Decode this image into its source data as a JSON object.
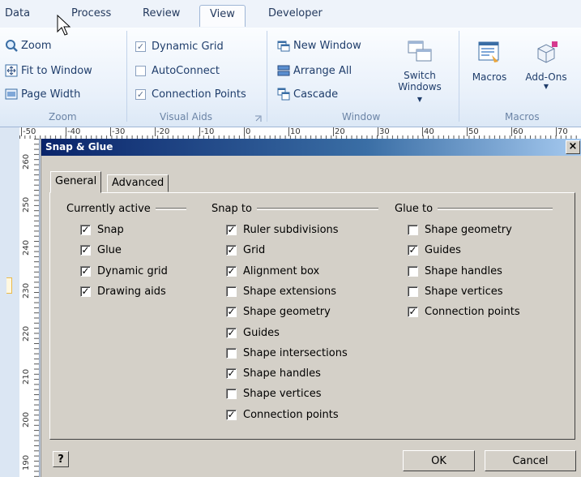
{
  "ribbon_tabs": [
    {
      "label": "Data"
    },
    {
      "label": "Process"
    },
    {
      "label": "Review"
    },
    {
      "label": "View",
      "active": true
    },
    {
      "label": "Developer"
    }
  ],
  "zoom_group": {
    "label": "Zoom",
    "buttons": [
      {
        "label": "Zoom",
        "icon": "magnifier-icon"
      },
      {
        "label": "Fit to Window",
        "icon": "fit-window-icon"
      },
      {
        "label": "Page Width",
        "icon": "page-width-icon"
      }
    ]
  },
  "visual_aids_group": {
    "label": "Visual Aids",
    "items": [
      {
        "label": "Dynamic Grid",
        "checked": true
      },
      {
        "label": "AutoConnect",
        "checked": false
      },
      {
        "label": "Connection Points",
        "checked": true
      }
    ]
  },
  "window_group": {
    "label": "Window",
    "buttons": [
      {
        "label": "New Window"
      },
      {
        "label": "Arrange All"
      },
      {
        "label": "Cascade"
      }
    ],
    "switch_windows": "Switch Windows"
  },
  "macros_group": {
    "label": "Macros",
    "macros": "Macros",
    "addons": "Add-Ons"
  },
  "ruler": {
    "h_labels": [
      "-50",
      "-40",
      "-30",
      "-20",
      "-10",
      "0",
      "10",
      "20",
      "30",
      "40",
      "50",
      "60",
      "70"
    ],
    "v_labels": [
      "260",
      "250",
      "240",
      "230",
      "220",
      "210",
      "200",
      "190"
    ]
  },
  "dialog": {
    "title": "Snap & Glue",
    "tabs": [
      {
        "label": "General",
        "selected": true
      },
      {
        "label": "Advanced",
        "selected": false
      }
    ],
    "currently_active": {
      "heading": "Currently active",
      "items": [
        {
          "label": "Snap",
          "checked": true
        },
        {
          "label": "Glue",
          "checked": true
        },
        {
          "label": "Dynamic grid",
          "checked": true
        },
        {
          "label": "Drawing aids",
          "checked": true
        }
      ]
    },
    "snap_to": {
      "heading": "Snap to",
      "items": [
        {
          "label": "Ruler subdivisions",
          "checked": true
        },
        {
          "label": "Grid",
          "checked": true
        },
        {
          "label": "Alignment box",
          "checked": true
        },
        {
          "label": "Shape extensions",
          "checked": false
        },
        {
          "label": "Shape geometry",
          "checked": true
        },
        {
          "label": "Guides",
          "checked": true
        },
        {
          "label": "Shape intersections",
          "checked": false
        },
        {
          "label": "Shape handles",
          "checked": true
        },
        {
          "label": "Shape vertices",
          "checked": false
        },
        {
          "label": "Connection points",
          "checked": true
        }
      ]
    },
    "glue_to": {
      "heading": "Glue to",
      "items": [
        {
          "label": "Shape geometry",
          "checked": false
        },
        {
          "label": "Guides",
          "checked": true
        },
        {
          "label": "Shape handles",
          "checked": false
        },
        {
          "label": "Shape vertices",
          "checked": false
        },
        {
          "label": "Connection points",
          "checked": true
        }
      ]
    },
    "ok_label": "OK",
    "cancel_label": "Cancel",
    "help_glyph": "?",
    "close_glyph": "×"
  }
}
